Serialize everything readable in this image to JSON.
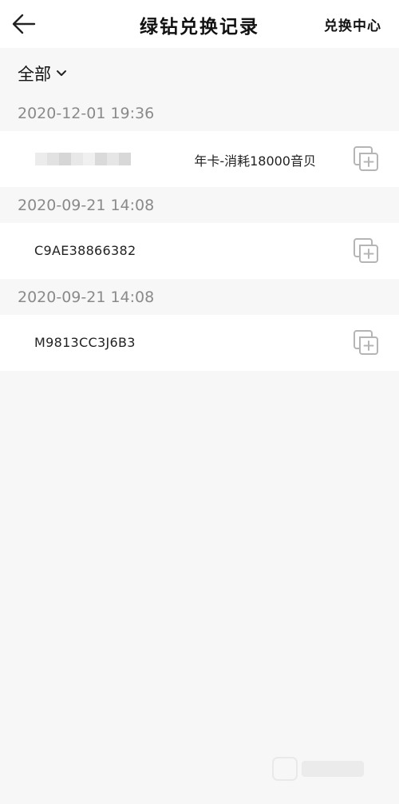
{
  "header": {
    "title": "绿钻兑换记录",
    "link_label": "兑换中心"
  },
  "filter": {
    "label": "全部"
  },
  "records": [
    {
      "date": "2020-12-01 19:36",
      "code": "",
      "code_redacted": true,
      "description": "年卡-消耗18000音贝"
    },
    {
      "date": "2020-09-21 14:08",
      "code": "C9AE38866382",
      "description": ""
    },
    {
      "date": "2020-09-21 14:08",
      "code": "M9813CC3J6B3",
      "description": ""
    }
  ],
  "icons": {
    "back": "arrow-left-icon",
    "dropdown": "chevron-down-icon",
    "copy": "copy-icon"
  },
  "colors": {
    "background": "#f7f7f7",
    "card": "#ffffff",
    "date_text": "#8a8a8a",
    "icon_gray": "#b5b5b5"
  }
}
